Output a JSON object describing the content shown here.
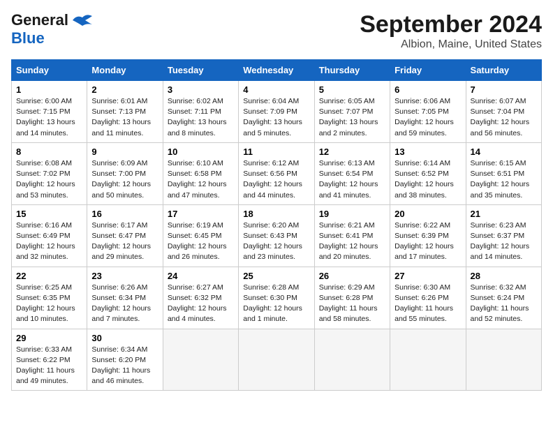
{
  "header": {
    "logo_general": "General",
    "logo_blue": "Blue",
    "title": "September 2024",
    "subtitle": "Albion, Maine, United States"
  },
  "weekdays": [
    "Sunday",
    "Monday",
    "Tuesday",
    "Wednesday",
    "Thursday",
    "Friday",
    "Saturday"
  ],
  "weeks": [
    [
      {
        "day": "1",
        "info": "Sunrise: 6:00 AM\nSunset: 7:15 PM\nDaylight: 13 hours\nand 14 minutes."
      },
      {
        "day": "2",
        "info": "Sunrise: 6:01 AM\nSunset: 7:13 PM\nDaylight: 13 hours\nand 11 minutes."
      },
      {
        "day": "3",
        "info": "Sunrise: 6:02 AM\nSunset: 7:11 PM\nDaylight: 13 hours\nand 8 minutes."
      },
      {
        "day": "4",
        "info": "Sunrise: 6:04 AM\nSunset: 7:09 PM\nDaylight: 13 hours\nand 5 minutes."
      },
      {
        "day": "5",
        "info": "Sunrise: 6:05 AM\nSunset: 7:07 PM\nDaylight: 13 hours\nand 2 minutes."
      },
      {
        "day": "6",
        "info": "Sunrise: 6:06 AM\nSunset: 7:05 PM\nDaylight: 12 hours\nand 59 minutes."
      },
      {
        "day": "7",
        "info": "Sunrise: 6:07 AM\nSunset: 7:04 PM\nDaylight: 12 hours\nand 56 minutes."
      }
    ],
    [
      {
        "day": "8",
        "info": "Sunrise: 6:08 AM\nSunset: 7:02 PM\nDaylight: 12 hours\nand 53 minutes."
      },
      {
        "day": "9",
        "info": "Sunrise: 6:09 AM\nSunset: 7:00 PM\nDaylight: 12 hours\nand 50 minutes."
      },
      {
        "day": "10",
        "info": "Sunrise: 6:10 AM\nSunset: 6:58 PM\nDaylight: 12 hours\nand 47 minutes."
      },
      {
        "day": "11",
        "info": "Sunrise: 6:12 AM\nSunset: 6:56 PM\nDaylight: 12 hours\nand 44 minutes."
      },
      {
        "day": "12",
        "info": "Sunrise: 6:13 AM\nSunset: 6:54 PM\nDaylight: 12 hours\nand 41 minutes."
      },
      {
        "day": "13",
        "info": "Sunrise: 6:14 AM\nSunset: 6:52 PM\nDaylight: 12 hours\nand 38 minutes."
      },
      {
        "day": "14",
        "info": "Sunrise: 6:15 AM\nSunset: 6:51 PM\nDaylight: 12 hours\nand 35 minutes."
      }
    ],
    [
      {
        "day": "15",
        "info": "Sunrise: 6:16 AM\nSunset: 6:49 PM\nDaylight: 12 hours\nand 32 minutes."
      },
      {
        "day": "16",
        "info": "Sunrise: 6:17 AM\nSunset: 6:47 PM\nDaylight: 12 hours\nand 29 minutes."
      },
      {
        "day": "17",
        "info": "Sunrise: 6:19 AM\nSunset: 6:45 PM\nDaylight: 12 hours\nand 26 minutes."
      },
      {
        "day": "18",
        "info": "Sunrise: 6:20 AM\nSunset: 6:43 PM\nDaylight: 12 hours\nand 23 minutes."
      },
      {
        "day": "19",
        "info": "Sunrise: 6:21 AM\nSunset: 6:41 PM\nDaylight: 12 hours\nand 20 minutes."
      },
      {
        "day": "20",
        "info": "Sunrise: 6:22 AM\nSunset: 6:39 PM\nDaylight: 12 hours\nand 17 minutes."
      },
      {
        "day": "21",
        "info": "Sunrise: 6:23 AM\nSunset: 6:37 PM\nDaylight: 12 hours\nand 14 minutes."
      }
    ],
    [
      {
        "day": "22",
        "info": "Sunrise: 6:25 AM\nSunset: 6:35 PM\nDaylight: 12 hours\nand 10 minutes."
      },
      {
        "day": "23",
        "info": "Sunrise: 6:26 AM\nSunset: 6:34 PM\nDaylight: 12 hours\nand 7 minutes."
      },
      {
        "day": "24",
        "info": "Sunrise: 6:27 AM\nSunset: 6:32 PM\nDaylight: 12 hours\nand 4 minutes."
      },
      {
        "day": "25",
        "info": "Sunrise: 6:28 AM\nSunset: 6:30 PM\nDaylight: 12 hours\nand 1 minute."
      },
      {
        "day": "26",
        "info": "Sunrise: 6:29 AM\nSunset: 6:28 PM\nDaylight: 11 hours\nand 58 minutes."
      },
      {
        "day": "27",
        "info": "Sunrise: 6:30 AM\nSunset: 6:26 PM\nDaylight: 11 hours\nand 55 minutes."
      },
      {
        "day": "28",
        "info": "Sunrise: 6:32 AM\nSunset: 6:24 PM\nDaylight: 11 hours\nand 52 minutes."
      }
    ],
    [
      {
        "day": "29",
        "info": "Sunrise: 6:33 AM\nSunset: 6:22 PM\nDaylight: 11 hours\nand 49 minutes."
      },
      {
        "day": "30",
        "info": "Sunrise: 6:34 AM\nSunset: 6:20 PM\nDaylight: 11 hours\nand 46 minutes."
      },
      {
        "day": "",
        "info": ""
      },
      {
        "day": "",
        "info": ""
      },
      {
        "day": "",
        "info": ""
      },
      {
        "day": "",
        "info": ""
      },
      {
        "day": "",
        "info": ""
      }
    ]
  ]
}
